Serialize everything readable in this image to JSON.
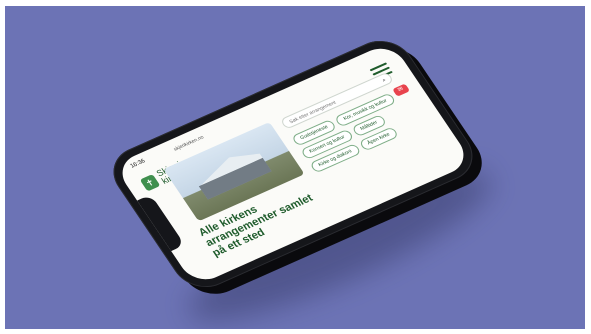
{
  "image": {
    "background_color": "#6c73b5",
    "phone_color": "#15161a",
    "accent_color": "#1f5c2c",
    "alert_color": "#e8434d"
  },
  "phone_screen": {
    "status_time": "16:36",
    "url": "skjerikirken.no",
    "logo_icon": "cross-leaf-icon",
    "logo_text": "Skjer i kirken",
    "menu_icon": "hamburger-menu-icon",
    "heading": "Alle kirkens arrangementer samlet på ett sted",
    "search_placeholder": "Søk etter arrangement",
    "search_icon": "search-icon",
    "chips": [
      "Gudstjeneste",
      "Kor, musikk og kultur",
      "Konsert og kultur",
      "Måltider",
      "Kirke og diakoni",
      "Åpen kirke"
    ],
    "fab_icon": "mail-icon"
  }
}
